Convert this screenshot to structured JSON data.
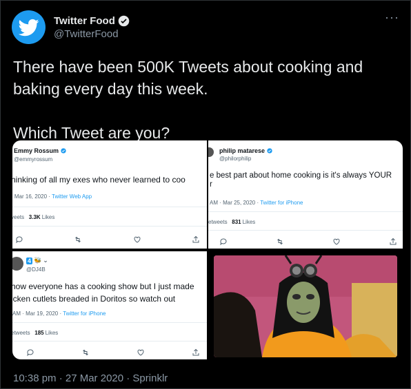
{
  "account": {
    "name": "Twitter Food",
    "handle": "@TwitterFood",
    "icon": "twitter-bird-icon"
  },
  "tweet": {
    "text": "There have been 500K Tweets about cooking and\nbaking every day this week.\n\nWhich Tweet are you?"
  },
  "media": [
    {
      "name": "Emmy Rossum",
      "handle": "@emmyrossum",
      "body": "hinking of all my exes who never learned to coo",
      "meta_date": "· Mar 16, 2020 · ",
      "meta_app": "Twitter Web App",
      "stats_prefix": "veets",
      "stats_value": "3.3K",
      "stats_label": "Likes"
    },
    {
      "name": "philip matarese",
      "handle": "@philorphilip",
      "body": "e best part about home cooking is it's always YOUR",
      "body2": "r",
      "meta_date": "AM · Mar 25, 2020 · ",
      "meta_app": "Twitter for iPhone",
      "stats_prefix": "etweets",
      "stats_value": "831",
      "stats_label": "Likes"
    },
    {
      "name": "4",
      "handle": "@DJ4B",
      "body": "how everyone has a cooking show but I just made",
      "body2": "icken cutlets breaded in Doritos so watch out",
      "meta_date": "AM · Mar 19, 2020 · ",
      "meta_app": "Twitter for iPhone",
      "stats_prefix": "etweets",
      "stats_value": "185",
      "stats_label": "Likes"
    }
  ],
  "footer": {
    "timestamp": "10:38 pm · 27 Mar 2020 · Sprinklr"
  },
  "colors": {
    "background": "#000000",
    "accent": "#1d9bf0",
    "text": "#e7e9ea",
    "secondary_text": "#8b98a5"
  }
}
